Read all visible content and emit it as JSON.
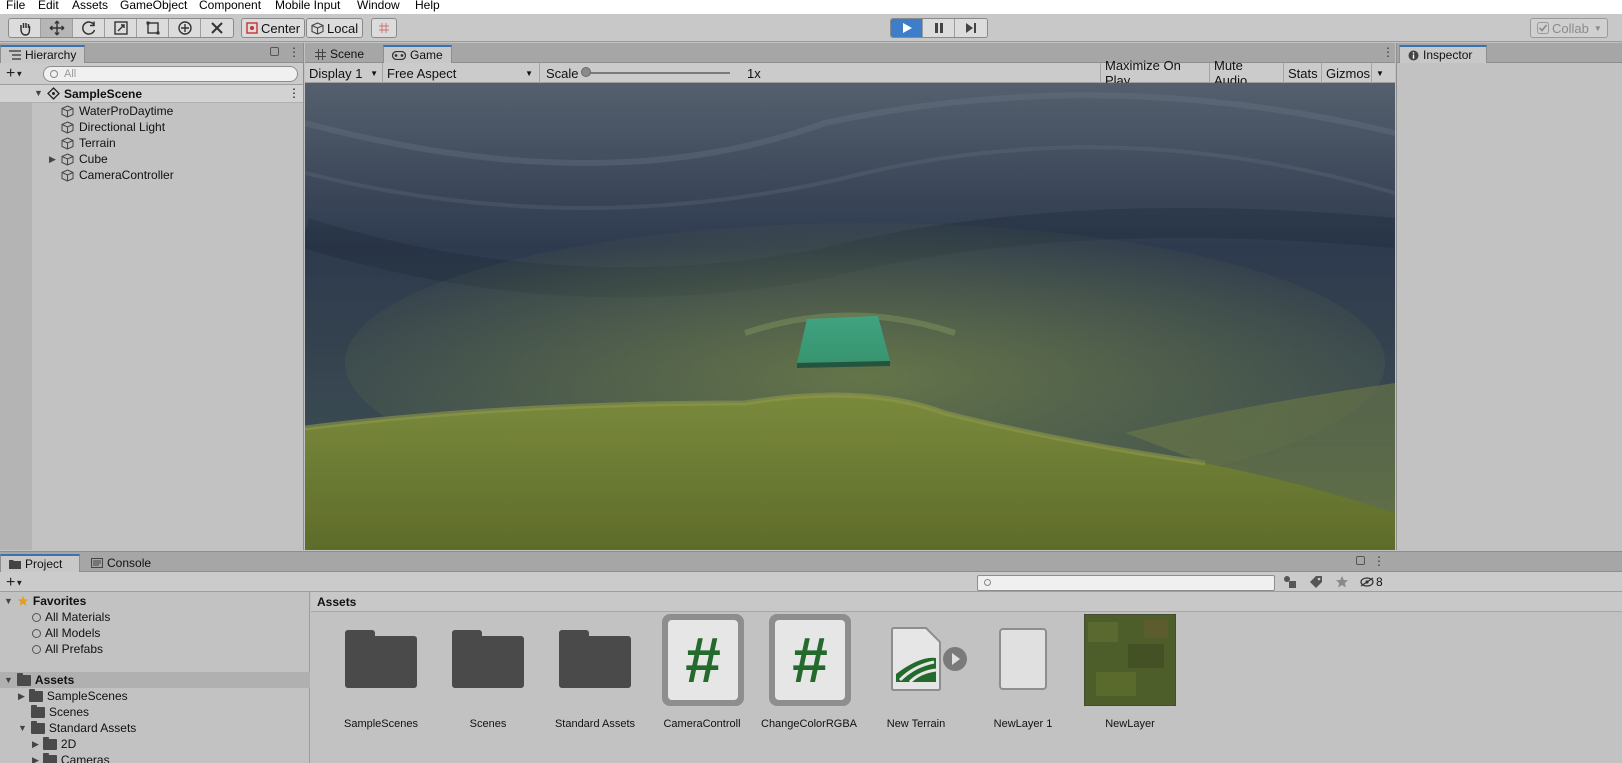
{
  "menu": [
    "File",
    "Edit",
    "Assets",
    "GameObject",
    "Component",
    "Mobile Input",
    "Window",
    "Help"
  ],
  "toolbar": {
    "pivot_label": "Center",
    "space_label": "Local",
    "collab_label": "Collab"
  },
  "hierarchy": {
    "tab": "Hierarchy",
    "search_placeholder": "All",
    "scene": "SampleScene",
    "items": [
      "WaterProDaytime",
      "Directional Light",
      "Terrain",
      "Cube",
      "CameraController"
    ]
  },
  "game": {
    "tabs": [
      "Scene",
      "Game"
    ],
    "display": "Display 1",
    "aspect": "Free Aspect",
    "scale_label": "Scale",
    "scale_value": "1x",
    "scale_fraction": 0.0,
    "buttons": [
      "Maximize On Play",
      "Mute Audio",
      "Stats",
      "Gizmos"
    ]
  },
  "inspector": {
    "tab": "Inspector"
  },
  "project": {
    "tabs": [
      "Project",
      "Console"
    ],
    "hidden_count": "8",
    "favorites_label": "Favorites",
    "favorites": [
      "All Materials",
      "All Models",
      "All Prefabs"
    ],
    "assets_label": "Assets",
    "tree": [
      "SampleScenes",
      "Scenes",
      "Standard Assets",
      "2D",
      "Cameras"
    ],
    "breadcrumb": "Assets",
    "assets": [
      "SampleScenes",
      "Scenes",
      "Standard Assets",
      "CameraControll",
      "ChangeColorRGBA",
      "New Terrain",
      "NewLayer 1",
      "NewLayer"
    ]
  },
  "colors": {
    "play_active": "#3e7ec8",
    "cube": "#3fa381",
    "script_hash": "#236a2c"
  }
}
